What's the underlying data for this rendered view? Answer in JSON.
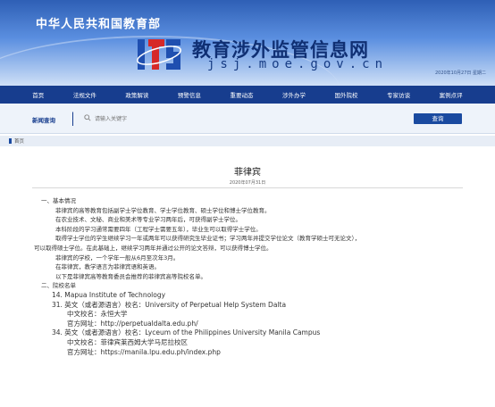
{
  "header": {
    "ministry": "中华人民共和国教育部",
    "site_title": "教育涉外监管信息网",
    "site_url": "jsj.moe.gov.cn",
    "date": "2020年10月27日 星期二"
  },
  "nav": [
    "首页",
    "法规文件",
    "政策解读",
    "预警信息",
    "重要动态",
    "涉外办学",
    "国外院校",
    "专家访谈",
    "案例点评"
  ],
  "search": {
    "label": "新闻查询",
    "placeholder": "请输入关键字",
    "button": "查询"
  },
  "breadcrumb": "首页",
  "article": {
    "title": "菲律宾",
    "date": "2020年07月31日",
    "s1": "一、基本情况",
    "p1": "菲律宾的高等教育包括副学士学位教育、学士学位教育、硕士学位和博士学位教育。",
    "p2": "在农业技术、文秘、商业和美术等专业学习两年后，可获得副学士学位。",
    "p3": "本科阶段的学习通常需要四年（工程学士需要五年），毕业生可以取得学士学位。",
    "p4a": "取得学士学位的学生继续学习一年或两年可以获得研究生毕业证书；学习两年并提交学位论文（教育学硕士可无论文），",
    "p4b": "可以取得硕士学位。在此基础上，继续学习两年并通过公开的论文答辩，可以获得博士学位。",
    "p5": "菲律宾的学校，一个学年一般从6月至次年3月。",
    "p6": "在菲律宾，教学语言为菲律宾语和英语。",
    "p7": "以下是菲律宾高等教育委员会推荐的菲律宾高等院校名单。",
    "s2": "二、院校名单",
    "u1": "14. Mapua Institute of Technology",
    "u2": "31. 英文（或者源语言）校名：University of Perpetual Help System Dalta",
    "u2cn": "中文校名：永恒大学",
    "u2web": "官方网址：http://perpetualdalta.edu.ph/",
    "u3": "34. 英文（或者源语言）校名：Lyceum of the Philippines University Manila Campus",
    "u3cn": "中文校名：菲律宾莱西姆大学马尼拉校区",
    "u3web": "官方网址：https://manila.lpu.edu.ph/index.php"
  },
  "colors": {
    "nav_bg": "#173d8e",
    "accent": "#1a4aa0",
    "title_blue": "#0f2f73"
  },
  "icons": {
    "search": "search-icon",
    "logo": "site-logo"
  }
}
